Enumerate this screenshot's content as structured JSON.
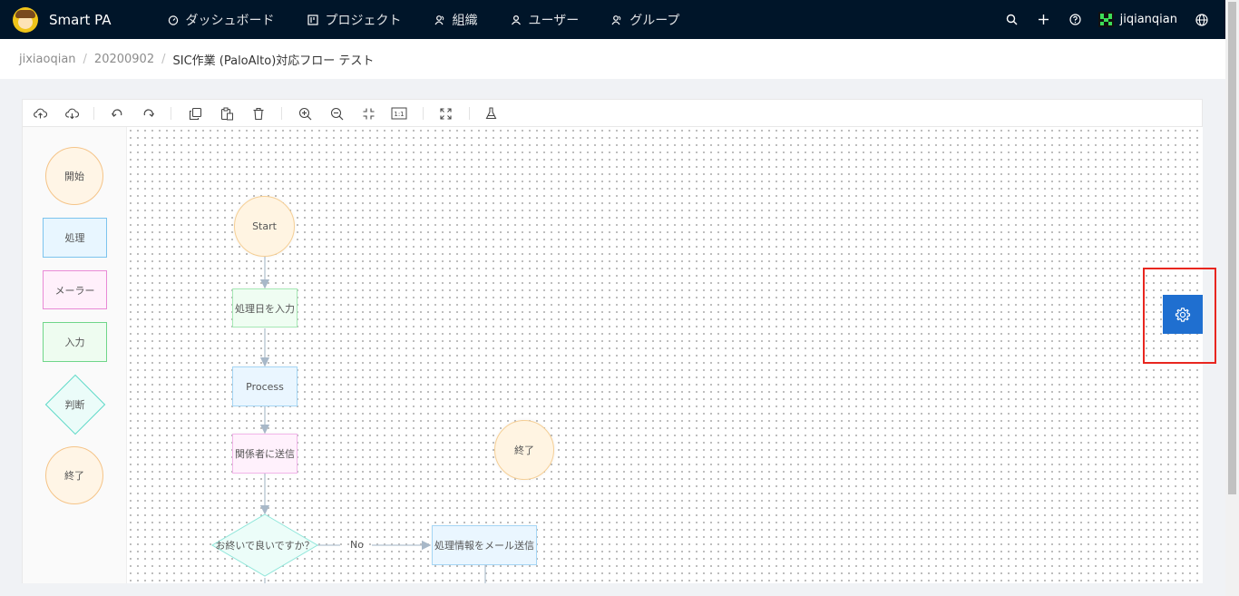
{
  "app": {
    "brand": "Smart PA"
  },
  "nav": {
    "items": [
      {
        "label": "ダッシュボード",
        "icon": "dashboard-icon"
      },
      {
        "label": "プロジェクト",
        "icon": "project-icon"
      },
      {
        "label": "組織",
        "icon": "team-icon"
      },
      {
        "label": "ユーザー",
        "icon": "user-icon"
      },
      {
        "label": "グループ",
        "icon": "group-icon"
      }
    ],
    "user": "jiqianqian"
  },
  "breadcrumb": {
    "items": [
      "jixiaoqian",
      "20200902"
    ],
    "separator": "/",
    "current": "SIC作業 (PaloAlto)対応フロー テスト"
  },
  "toolbar": {
    "icons": [
      "upload-icon",
      "download-icon",
      "undo-icon",
      "redo-icon",
      "copy-icon",
      "paste-icon",
      "delete-icon",
      "zoom-in-icon",
      "zoom-out-icon",
      "fit-icon",
      "actual-size-icon",
      "fullscreen-icon",
      "test-flask-icon"
    ]
  },
  "palette": {
    "start": "開始",
    "process": "処理",
    "mailer": "メーラー",
    "input": "入力",
    "decision": "判断",
    "end": "終了"
  },
  "flow": {
    "start": "Start",
    "input_date": "処理日を入力",
    "process": "Process",
    "send_related": "関係者に送信",
    "end": "終了",
    "decision": "お終いで良いですか？",
    "no_label": "No",
    "send_mail": "処理情報をメール送信"
  },
  "colors": {
    "topbar": "#001529",
    "accent": "#1f6fd0",
    "highlight": "#e8261f"
  }
}
